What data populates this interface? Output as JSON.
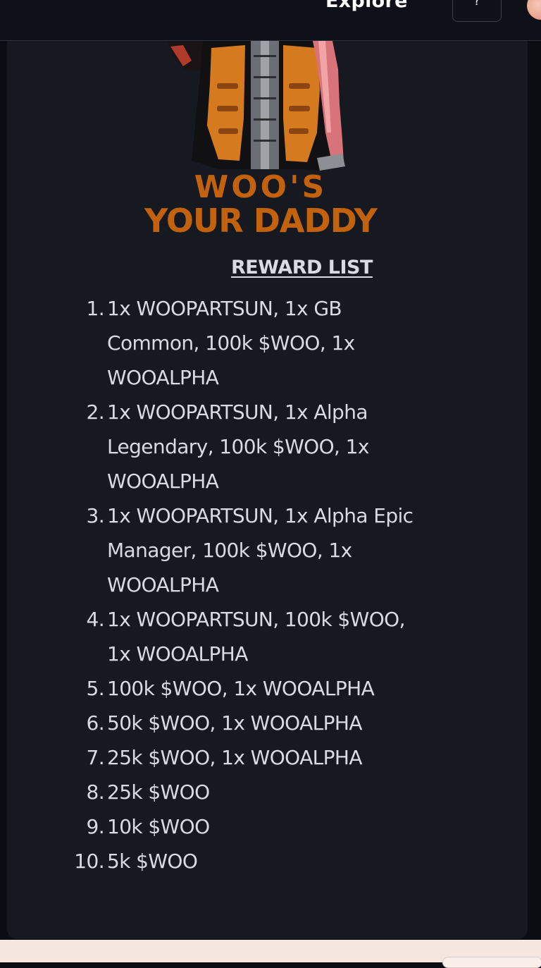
{
  "nav": {
    "explore_label": "Explore",
    "help_label": "?"
  },
  "artwork": {
    "logo_line1": "WOO'S",
    "logo_line2": "YOUR DADDY",
    "logo_color": "#c2620f"
  },
  "rewards": {
    "title": "REWARD LIST",
    "items": [
      {
        "num": "1.",
        "text": "1x WOOPARTSUN, 1x GB Common, 100k $WOO, 1x WOOALPHA"
      },
      {
        "num": "2.",
        "text": "1x WOOPARTSUN, 1x Alpha Legendary, 100k $WOO, 1x WOOALPHA"
      },
      {
        "num": "3.",
        "text": "1x WOOPARTSUN, 1x Alpha Epic Manager, 100k $WOO, 1x WOOALPHA"
      },
      {
        "num": "4.",
        "text": "1x WOOPARTSUN, 100k $WOO, 1x WOOALPHA"
      },
      {
        "num": "5.",
        "text": "100k $WOO, 1x WOOALPHA"
      },
      {
        "num": "6.",
        "text": "50k $WOO, 1x WOOALPHA"
      },
      {
        "num": "7.",
        "text": "25k $WOO, 1x WOOALPHA"
      },
      {
        "num": "8.",
        "text": "25k $WOO"
      },
      {
        "num": "9.",
        "text": "10k $WOO"
      },
      {
        "num": "10.",
        "text": "5k $WOO"
      }
    ]
  },
  "colors": {
    "background": "#0b0d12",
    "card": "#16191f",
    "text": "#d8dbe2",
    "accent_orange": "#c2620f"
  }
}
